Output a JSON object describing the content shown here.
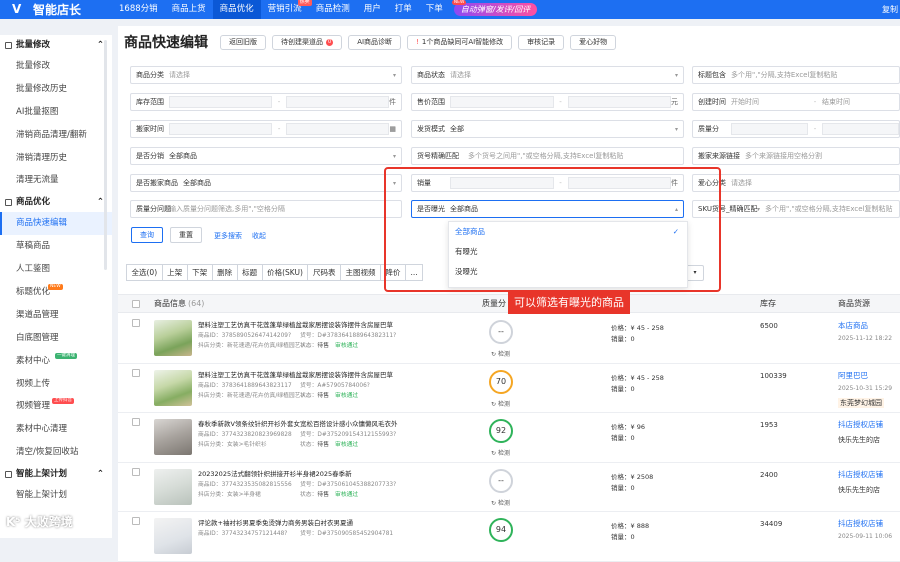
{
  "app": {
    "name": "智能店长",
    "top_right": "复制"
  },
  "topnav": [
    {
      "label": "1688分销",
      "active": false,
      "tag": ""
    },
    {
      "label": "商品上货",
      "active": false,
      "tag": ""
    },
    {
      "label": "商品优化",
      "active": true,
      "tag": ""
    },
    {
      "label": "营销引流",
      "active": false,
      "tag": "热卖"
    },
    {
      "label": "商品检测",
      "active": false,
      "tag": ""
    },
    {
      "label": "用户",
      "active": false,
      "tag": ""
    },
    {
      "label": "打单",
      "active": false,
      "tag": ""
    },
    {
      "label": "下单",
      "active": false,
      "tag": ""
    }
  ],
  "promo": {
    "text": "自动弹窗/发评/回评",
    "tag": "NEW"
  },
  "sidebar": {
    "sections": [
      {
        "title": "批量修改",
        "items": [
          {
            "label": "批量修改",
            "active": false,
            "badge": ""
          },
          {
            "label": "批量修改历史",
            "active": false,
            "badge": ""
          },
          {
            "label": "AI批量抠图",
            "active": false,
            "badge": ""
          },
          {
            "label": "滞销商品清理/翻新",
            "active": false,
            "badge": ""
          },
          {
            "label": "滞销清理历史",
            "active": false,
            "badge": ""
          },
          {
            "label": "清理无流量",
            "active": false,
            "badge": ""
          }
        ]
      },
      {
        "title": "商品优化",
        "items": [
          {
            "label": "商品快速编辑",
            "active": true,
            "badge": ""
          },
          {
            "label": "草稿商品",
            "active": false,
            "badge": ""
          },
          {
            "label": "人工鉴图",
            "active": false,
            "badge": ""
          },
          {
            "label": "标题优化",
            "active": false,
            "badge": "NEW"
          },
          {
            "label": "渠道品管理",
            "active": false,
            "badge": ""
          },
          {
            "label": "白底图管理",
            "active": false,
            "badge": ""
          },
          {
            "label": "素材中心",
            "active": false,
            "badge": "一键清理"
          },
          {
            "label": "视频上传",
            "active": false,
            "badge": ""
          },
          {
            "label": "视频管理",
            "active": false,
            "badge": "上传抖音"
          },
          {
            "label": "素材中心清理",
            "active": false,
            "badge": ""
          },
          {
            "label": "清空/恢复回收站",
            "active": false,
            "badge": ""
          }
        ]
      },
      {
        "title": "智能上架计划",
        "items": [
          {
            "label": "智能上架计划",
            "active": false,
            "badge": ""
          }
        ]
      }
    ]
  },
  "page": {
    "title": "商品快速编辑"
  },
  "toolbar": [
    {
      "label": "返回旧版",
      "count": "",
      "icon": ""
    },
    {
      "label": "待创建渠道品",
      "count": "0",
      "icon": ""
    },
    {
      "label": "AI商品诊断",
      "count": "",
      "icon": ""
    },
    {
      "label": "1个商品缺同可AI智能修改",
      "count": "",
      "icon": "!"
    },
    {
      "label": "审核记录",
      "count": "",
      "icon": ""
    },
    {
      "label": "爱心好物",
      "count": "",
      "icon": ""
    }
  ],
  "filters": {
    "goods_category": {
      "label": "商品分类",
      "placeholder": "请选择"
    },
    "goods_status": {
      "label": "商品状态",
      "placeholder": "请选择"
    },
    "title_contains": {
      "label": "标题包含",
      "placeholder": "多个用\",\"分隔,支持Excel复制粘贴"
    },
    "stock_range": {
      "label": "库存范围",
      "unit": "件"
    },
    "price_range": {
      "label": "售价范围",
      "unit": "元"
    },
    "create_time": {
      "label": "创建时间",
      "start": "开始时间",
      "end": "结束时间"
    },
    "move_time": {
      "label": "搬家时间"
    },
    "ship_mode": {
      "label": "发货模式",
      "value": "全部"
    },
    "quality_score": {
      "label": "质量分"
    },
    "is_shared": {
      "label": "是否分销",
      "value": "全部商品"
    },
    "sku_code_match": {
      "label": "货号精确匹配",
      "placeholder": "多个货号之间用\",\"或空格分隔,支持Excel复制粘贴"
    },
    "move_source_link": {
      "label": "搬家来源链接",
      "placeholder": "多个来源链接用空格分割"
    },
    "is_moved": {
      "label": "是否搬家商品",
      "value": "全部商品"
    },
    "sales": {
      "label": "销量",
      "unit": "件"
    },
    "shop_category": {
      "label": "爱心分类",
      "placeholder": "请选择"
    },
    "quality_issue": {
      "label": "质量分问题",
      "placeholder": "输入质量分问题筛选,多用\",\"空格分隔"
    },
    "exposure": {
      "label": "是否曝光",
      "value": "全部商品"
    },
    "sku_exact": {
      "label": "SKU货号_精确匹配",
      "placeholder": "多个用\",\"或空格分隔,支持Excel复制粘贴"
    },
    "query_label": "查询",
    "reset_label": "重置",
    "more_filter_label": "更多搜索",
    "collapse_label": "收起"
  },
  "exposure_dropdown": {
    "options": [
      {
        "label": "全部商品",
        "selected": true
      },
      {
        "label": "有曝光",
        "selected": false
      },
      {
        "label": "没曝光",
        "selected": false
      }
    ]
  },
  "annotation": "可以筛选有曝光的商品",
  "op_bar": [
    "全选(0)",
    "上架",
    "下架",
    "删除",
    "标题",
    "价格(SKU)",
    "尺码表",
    "主图视频",
    "降价",
    "..."
  ],
  "table": {
    "headers": [
      "商品信息",
      "(64)",
      "质量分",
      "",
      "库存",
      "商品货源"
    ],
    "rows": [
      {
        "name": "塑料注塑工艺仿真干花莲蓬草绿植盆栽家居摆设装饰摆件含房屋巴草",
        "meta1": "商品ID：378589052647414209?",
        "meta2": "货号：D#378364188964382311?",
        "meta3": "抖店分类：新花速递/花卉仿真/绿植园艺>...",
        "status_label": "状态：",
        "status": "待售",
        "audit": "审核通过",
        "score": "--",
        "detect": "检测",
        "price": "价格：¥ 45 - 258",
        "sales": "销量：0",
        "stock": "6500",
        "src": "本店商品",
        "src_date": "2025-11-12 18:22",
        "src_sub": "",
        "ring_color": "#cfd3da"
      },
      {
        "name": "塑料注塑工艺仿真干花莲蓬草绿植盆栽家居摆设装饰摆件含房屋巴草",
        "meta1": "商品ID：3783641889643823117",
        "meta2": "货号：A#57905784006?",
        "meta3": "抖店分类：新花速递/花卉仿真/绿植园艺>...",
        "status_label": "状态：",
        "status": "待售",
        "audit": "审核通过",
        "score": "70",
        "detect": "检测",
        "price": "价格：¥ 45 - 258",
        "sales": "销量：0",
        "stock": "100339",
        "src": "阿里巴巴",
        "src_date": "2025-10-31 15:29",
        "src_sub": "东莞梦幻城园",
        "ring_color": "#f5a623"
      },
      {
        "name": "春秋季新款V领条纹针织开衫外套女宽松百搭设计感小众慵懒风毛衣外",
        "meta1": "商品ID：3774323820823969828",
        "meta2": "货号：D#375209154312155993?",
        "meta3": "抖店分类：女装>毛针织衫",
        "status_label": "状态：",
        "status": "待售",
        "audit": "审核通过",
        "score": "92",
        "detect": "检测",
        "price": "价格：¥ 96",
        "sales": "销量：0",
        "stock": "1953",
        "src": "抖店授权店铺",
        "src_date": "",
        "src_sub": "快乐先生的店",
        "ring_color": "#2fb35a"
      },
      {
        "name": "20232025法式翻领针织拼接开衫半身裙2025春季新",
        "meta1": "商品ID：3774323535082815556",
        "meta2": "货号：D#375061045388207733?",
        "meta3": "抖店分类：女装>半身裙",
        "status_label": "状态：",
        "status": "待售",
        "audit": "审核通过",
        "score": "--",
        "detect": "检测",
        "price": "价格：¥ 2508",
        "sales": "销量：0",
        "stock": "2400",
        "src": "抖店授权店铺",
        "src_date": "",
        "src_sub": "快乐先生的店",
        "ring_color": "#cfd3da"
      },
      {
        "name": "评论款+袖衬衫男夏季免烫弹力商务男装白衬衣男夏通",
        "meta1": "商品ID：37743234757121448?",
        "meta2": "货号：D#375090585452904781",
        "meta3": "",
        "status_label": "",
        "status": "",
        "audit": "",
        "score": "94",
        "detect": "",
        "price": "价格：¥ 888",
        "sales": "销量：0",
        "stock": "34409",
        "src": "抖店授权店铺",
        "src_date": "2025-09-11 10:06",
        "src_sub": "",
        "ring_color": "#2fb35a"
      }
    ]
  },
  "watermark": "K⁵ 大败跨境",
  "colors": {
    "brand": "#1d6ff2",
    "annotation": "#e8352a",
    "success": "#2fb35a",
    "warning": "#f5a623"
  }
}
